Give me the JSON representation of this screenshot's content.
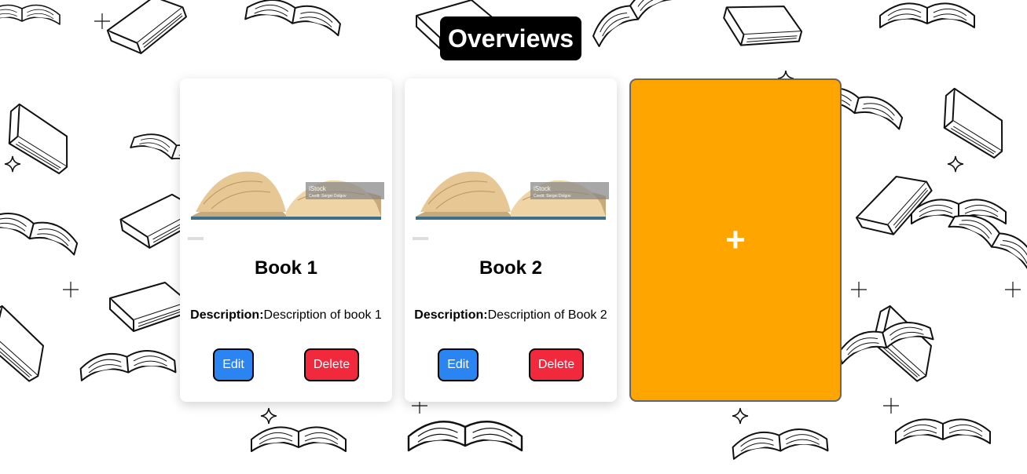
{
  "page": {
    "title": "Overviews"
  },
  "books": [
    {
      "title": "Book 1",
      "description_label": "Description:",
      "description": "Description of book 1",
      "edit_label": "Edit",
      "delete_label": "Delete",
      "watermark": "iStock",
      "credit": "Credit: Sergei Dolgov"
    },
    {
      "title": "Book 2",
      "description_label": "Description:",
      "description": "Description of Book 2",
      "edit_label": "Edit",
      "delete_label": "Delete",
      "watermark": "iStock",
      "credit": "Credit: Sergei Dolgov"
    }
  ],
  "add_card": {
    "label": "+"
  },
  "colors": {
    "title_bg": "#000000",
    "edit_button": "#2a84f2",
    "delete_button": "#f2283d",
    "add_card": "#ffa500"
  },
  "icons": {
    "background": "book-doodle-pattern",
    "cover": "open-book-photo"
  }
}
